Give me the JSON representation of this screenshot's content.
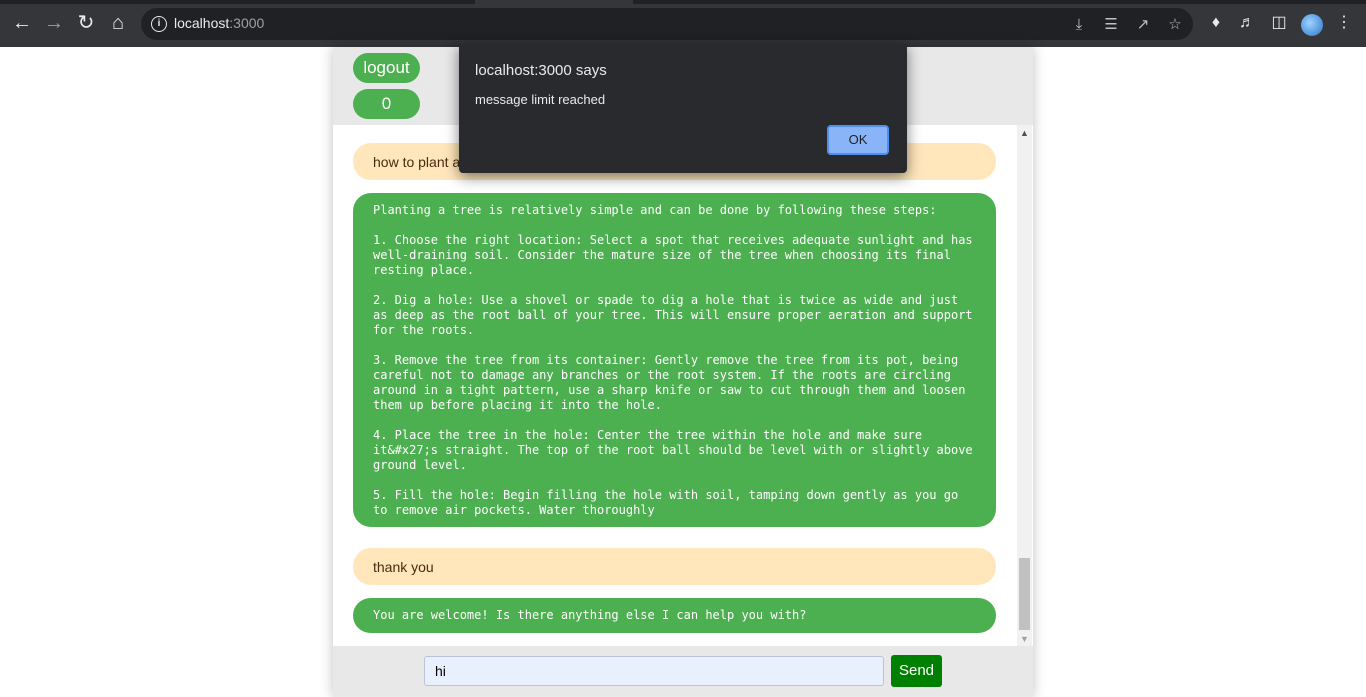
{
  "browser": {
    "url_host": "localhost",
    "url_port": ":3000"
  },
  "header": {
    "logout_label": "logout",
    "count_label": "0"
  },
  "messages": [
    {
      "role": "user",
      "text": "how to plant a tree"
    },
    {
      "role": "bot",
      "text": "Planting a tree is relatively simple and can be done by following these steps:\n\n1. Choose the right location: Select a spot that receives adequate sunlight and has well-draining soil. Consider the mature size of the tree when choosing its final resting place.\n\n2. Dig a hole: Use a shovel or spade to dig a hole that is twice as wide and just as deep as the root ball of your tree. This will ensure proper aeration and support for the roots.\n\n3. Remove the tree from its container: Gently remove the tree from its pot, being careful not to damage any branches or the root system. If the roots are circling around in a tight pattern, use a sharp knife or saw to cut through them and loosen them up before placing it into the hole.\n\n4. Place the tree in the hole: Center the tree within the hole and make sure it&#x27;s straight. The top of the root ball should be level with or slightly above ground level.\n\n5. Fill the hole: Begin filling the hole with soil, tamping down gently as you go to remove air pockets. Water thoroughly"
    },
    {
      "role": "user",
      "text": "thank you"
    },
    {
      "role": "bot",
      "text": "You are welcome! Is there anything else I can help you with?"
    }
  ],
  "composer": {
    "input_value": "hi",
    "send_label": "Send"
  },
  "dialog": {
    "title": "localhost:3000 says",
    "message": "message limit reached",
    "ok_label": "OK"
  },
  "colors": {
    "user_bubble": "#ffe6bb",
    "bot_bubble": "#4caf50",
    "send_button": "#008000"
  }
}
